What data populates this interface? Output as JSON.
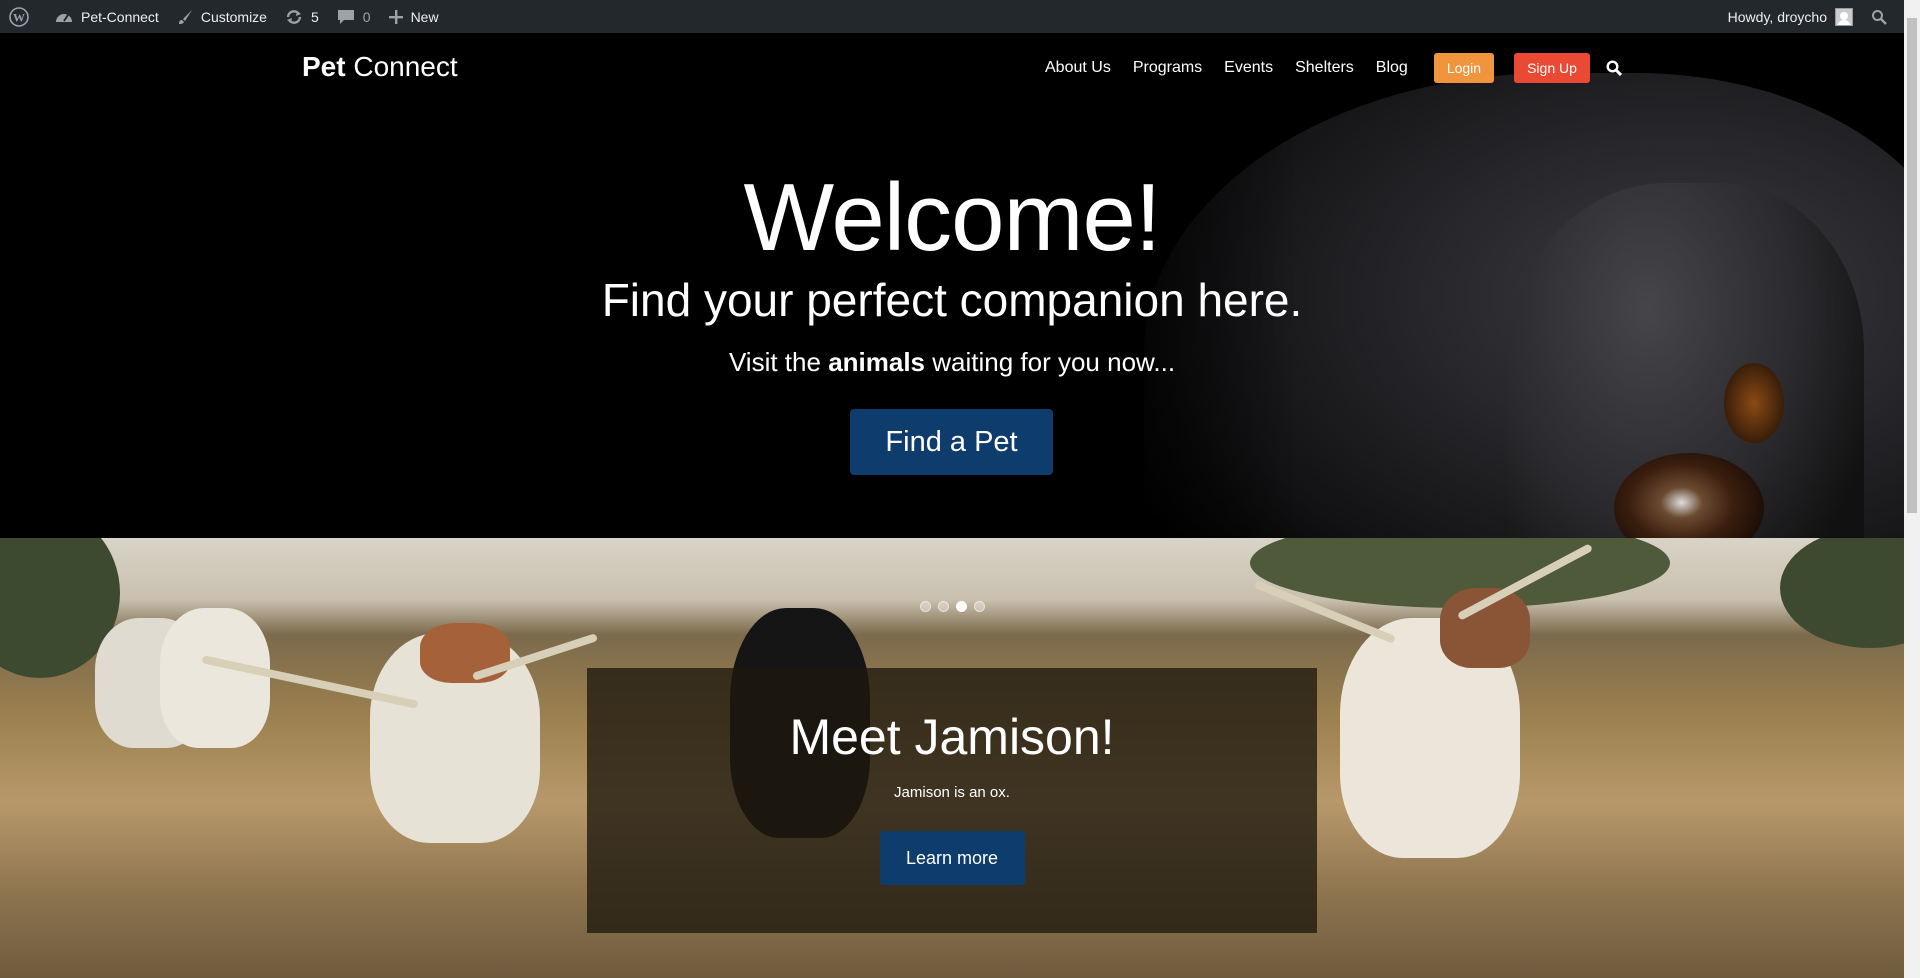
{
  "adminbar": {
    "site_name": "Pet-Connect",
    "customize": "Customize",
    "updates_count": "5",
    "comments_count": "0",
    "new_label": "New",
    "howdy": "Howdy, droycho"
  },
  "nav": {
    "brand_bold": "Pet",
    "brand_light": " Connect",
    "items": [
      "About Us",
      "Programs",
      "Events",
      "Shelters",
      "Blog"
    ],
    "login": "Login",
    "signup": "Sign Up"
  },
  "hero": {
    "title": "Welcome!",
    "tagline": "Find your perfect companion here.",
    "visit_prefix": "Visit the ",
    "visit_bold": "animals",
    "visit_suffix": " waiting for you now...",
    "cta": "Find a Pet"
  },
  "slider": {
    "dots_total": 4,
    "active_dot": 3,
    "title": "Meet Jamison!",
    "text": "Jamison is an ox.",
    "cta": "Learn more"
  },
  "colors": {
    "adminbar_bg": "#23282d",
    "login_btn": "#f0943d",
    "signup_btn": "#ea4a33",
    "primary_btn": "#0e3c6c"
  }
}
